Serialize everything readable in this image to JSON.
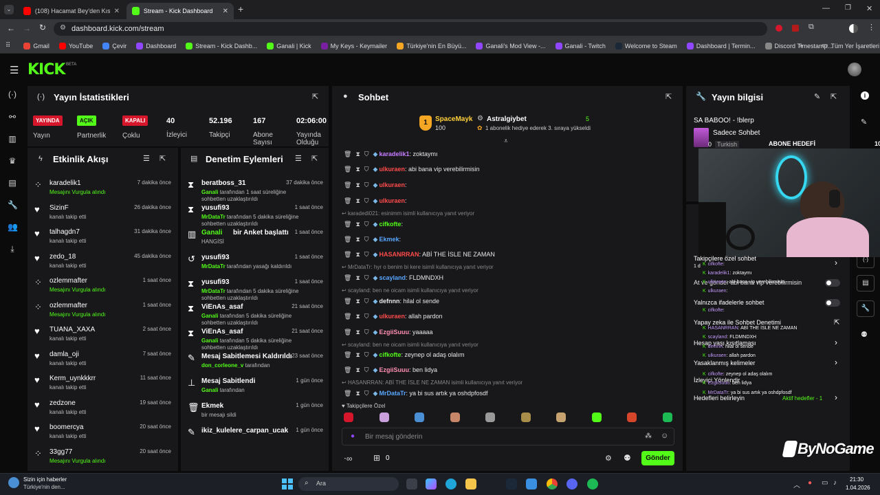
{
  "browser": {
    "tabs": [
      {
        "title": "(108) Hacamat Bey'den Kıssadan",
        "color": "#ff0000"
      },
      {
        "title": "Stream - Kick Dashboard",
        "color": "#53fc18"
      }
    ],
    "new_tab": "+",
    "url": "dashboard.kick.com/stream",
    "bookmarks": [
      {
        "label": "Gmail",
        "color": "#ea4335"
      },
      {
        "label": "YouTube",
        "color": "#ff0000"
      },
      {
        "label": "Çevir",
        "color": "#4285f4"
      },
      {
        "label": "Dashboard",
        "color": "#9146ff"
      },
      {
        "label": "Stream - Kick Dashb...",
        "color": "#53fc18"
      },
      {
        "label": "Ganali | Kick",
        "color": "#53fc18"
      },
      {
        "label": "My Keys - Keymailer",
        "color": "#7a1fa2"
      },
      {
        "label": "Türkiye'nin En Büyü...",
        "color": "#f5a623"
      },
      {
        "label": "Ganali's Mod View -...",
        "color": "#9146ff"
      },
      {
        "label": "Ganali - Twitch",
        "color": "#9146ff"
      },
      {
        "label": "Welcome to Steam",
        "color": "#1b2838"
      },
      {
        "label": "Dashboard | Termin...",
        "color": "#9146ff"
      },
      {
        "label": "Discord Timestamp...",
        "color": "#888888"
      }
    ],
    "all_bookmarks": "Tüm Yer İşaretleri"
  },
  "kick": {
    "logo": "KICK",
    "beta": "BETA"
  },
  "stats": {
    "title": "Yayın İstatistikleri",
    "items": [
      {
        "badge": "YAYINDA",
        "badge_color": "#d6162b",
        "label": "Yayın"
      },
      {
        "badge": "AÇIK",
        "badge_color": "#53fc18",
        "label": "Partnerlik"
      },
      {
        "badge": "KAPALI",
        "badge_color": "#d6162b",
        "label": "Çoklu"
      },
      {
        "value": "40",
        "label": "İzleyici"
      },
      {
        "value": "52.196",
        "label": "Takipçi"
      },
      {
        "value": "167",
        "label": "Abone Sayısı"
      },
      {
        "value": "02:06:00",
        "label": "Yayında Olduğu"
      }
    ]
  },
  "activity": {
    "title": "Etkinlik Akışı",
    "items": [
      {
        "name": "karadelik1",
        "desc": "Mesajını Vurgula alındı",
        "highlight": true,
        "time": "7 dakika önce"
      },
      {
        "name": "SizinF",
        "desc": "kanalı takip etti",
        "highlight": false,
        "time": "26 dakika önce"
      },
      {
        "name": "talhagdn7",
        "desc": "kanalı takip etti",
        "highlight": false,
        "time": "31 dakika önce"
      },
      {
        "name": "zedo_18",
        "desc": "kanalı takip etti",
        "highlight": false,
        "time": "45 dakika önce"
      },
      {
        "name": "ozlemmafter",
        "desc": "Mesajını Vurgula alındı",
        "highlight": true,
        "time": "1 saat önce"
      },
      {
        "name": "ozlemmafter",
        "desc": "Mesajını Vurgula alındı",
        "highlight": true,
        "time": "1 saat önce"
      },
      {
        "name": "TUANA_XAXA",
        "desc": "kanalı takip etti",
        "highlight": false,
        "time": "2 saat önce"
      },
      {
        "name": "damla_oji",
        "desc": "kanalı takip etti",
        "highlight": false,
        "time": "7 saat önce"
      },
      {
        "name": "Kerm_uynkkkrr",
        "desc": "kanalı takip etti",
        "highlight": false,
        "time": "11 saat önce"
      },
      {
        "name": "zedzone",
        "desc": "kanalı takip etti",
        "highlight": false,
        "time": "19 saat önce"
      },
      {
        "name": "boomercya",
        "desc": "kanalı takip etti",
        "highlight": false,
        "time": "20 saat önce"
      },
      {
        "name": "33gg77",
        "desc": "Mesajını Vurgula alındı",
        "highlight": true,
        "time": "20 saat önce"
      }
    ]
  },
  "moderation": {
    "title": "Denetim Eylemleri",
    "items": [
      {
        "icon": "⧗",
        "title": "beratboss_31",
        "actor": "Ganali",
        "desc": "tarafından 1 saat süreliğine sohbetten uzaklaştırıldı",
        "time": "37 dakika önce"
      },
      {
        "icon": "⧗",
        "title": "yusufi93",
        "actor": "MrDataTr",
        "desc": "tarafından 5 dakika süreliğine sohbetten uzaklaştırıldı",
        "time": "1 saat önce"
      },
      {
        "icon": "▥",
        "title": "bir Anket başlattı",
        "actor": "Ganali",
        "desc": "HANGİSİ",
        "time": "1 saat önce"
      },
      {
        "icon": "↺",
        "title": "yusufi93",
        "actor": "MrDataTr",
        "desc": "tarafından yasağı kaldırıldı",
        "time": "1 saat önce"
      },
      {
        "icon": "⧗",
        "title": "yusufi93",
        "actor": "MrDataTr",
        "desc": "tarafından 5 dakika süreliğine sohbetten uzaklaştırıldı",
        "time": "1 saat önce"
      },
      {
        "icon": "⧗",
        "title": "ViEnAs_asaf",
        "actor": "Ganali",
        "desc": "tarafından 5 dakika süreliğine sohbetten uzaklaştırıldı",
        "time": "21 saat önce"
      },
      {
        "icon": "⧗",
        "title": "ViEnAs_asaf",
        "actor": "Ganali",
        "desc": "tarafından 5 dakika süreliğine sohbetten uzaklaştırıldı",
        "time": "21 saat önce"
      },
      {
        "icon": "✎",
        "title": "Mesaj Sabitlemesi Kaldırıldı",
        "actor": "don_corleone_v",
        "desc": "tarafından",
        "time": "23 saat önce"
      },
      {
        "icon": "⊥",
        "title": "Mesaj Sabitlendi",
        "actor": "Ganali",
        "desc": "tarafından",
        "time": "1 gün önce"
      },
      {
        "icon": "🗑",
        "title": "Ekmek",
        "actor": "",
        "desc": "bir mesajı sildi",
        "time": "1 gün önce"
      },
      {
        "icon": "✎",
        "title": "ikiz_kulelere_carpan_ucak",
        "actor": "",
        "desc": "",
        "time": "1 gün önce"
      }
    ]
  },
  "chat": {
    "title": "Sohbet",
    "gift": {
      "user1": "SpaceMayk",
      "count": "100",
      "rank": "1",
      "user2": "Astralgiybet",
      "num": "5",
      "text": "1 abonelik hediye ederek 3. sıraya yükseldi"
    },
    "messages": [
      {
        "user": "karadelik1",
        "color": "#c77dff",
        "text": ": zoktaymı"
      },
      {
        "user": "ulkuraen",
        "color": "#ff4b4b",
        "text": ": abi bana vip verebilirmisin"
      },
      {
        "user": "ulkuraen",
        "color": "#ff4b4b",
        "text": ":"
      },
      {
        "user": "ulkuraen",
        "color": "#ff4b4b",
        "text": ":"
      },
      {
        "reply": "karadedi021: esinimm isimli kullanıcıya yanıt veriyor"
      },
      {
        "user": "cifkofte",
        "color": "#53fc18",
        "text": ":"
      },
      {
        "user": "Ekmek",
        "color": "#58a6ff",
        "text": ":"
      },
      {
        "user": "HASANRRAN",
        "color": "#ff4b4b",
        "text": ": ABİ THE İSLE NE ZAMAN"
      },
      {
        "reply": "MrDataTr: hyr o benim bi kere isimli kullanıcıya yanıt veriyor"
      },
      {
        "user": "scayland",
        "color": "#58a6ff",
        "text": ": FLDMNDXH"
      },
      {
        "reply": "scayland: ben ne oicam isimli kullanıcıya yanıt veriyor"
      },
      {
        "user": "defnnn",
        "color": "#e8e8e8",
        "text": ": hilal ol sende"
      },
      {
        "user": "ulkuraen",
        "color": "#ff4b4b",
        "text": ": allah pardon"
      },
      {
        "user": "EzgiiSuuu",
        "color": "#ff8fb1",
        "text": ": yaaaaa"
      },
      {
        "reply": "scayland: ben ne oicam isimli kullanıcıya yanıt veriyor"
      },
      {
        "user": "cifkofte",
        "color": "#53fc18",
        "text": ": zeynep ol adaş olalım"
      },
      {
        "user": "EzgiiSuuu",
        "color": "#ff8fb1",
        "text": ": ben lidya"
      },
      {
        "reply": "HASANRRAN: ABİ THE İSLE NE ZAMAN isimli kullanıcıya yanıt veriyor"
      },
      {
        "user": "MrDataTr",
        "color": "#58a6ff",
        "text": ": ya bi sus artık ya oshdpfosdf"
      }
    ],
    "followers_only": "Takipçilere Özel",
    "input_placeholder": "Bir mesaj gönderin",
    "points": "0",
    "send": "Gönder"
  },
  "info": {
    "title": "Yayın bilgisi",
    "stream_title": "SA BABOO! - !blerp",
    "category": "Sadece Sohbet",
    "viewers": "0",
    "lang": "Turkish",
    "goal": "ABONE HEDEFİ",
    "goal_num": "10"
  },
  "settings": {
    "followers_chat": "Takipçilere özel sohbet",
    "followers_chat_sub": "1 d",
    "chat_row2": "At ve gönder abi bana vip verebilirmisin",
    "emotes_chat": "Yalnızca ifadelerle sohbet",
    "ai_mod": "Yapay zeka ile Sohbet Denetimi",
    "account_limit": "Hesap yaşı kısıtlaması",
    "banned_words": "Yasaklanmış kelimeler",
    "viewer_redirect": "İzleyici Yönlendir",
    "goals": "Hedefleri belirleyin",
    "active_goals": "Aktif hedefler - 1"
  },
  "overlay_chat": [
    {
      "user": "cifkofte",
      "text": ":"
    },
    {
      "user": "karadelik1",
      "text": ": zoktaymı"
    },
    {
      "user": "ulkuraen",
      "text": ": abi bana vip verebilirmisin"
    },
    {
      "user": "ulkuraen",
      "text": ":"
    },
    {
      "user": "cifkofte",
      "text": ":"
    },
    {
      "user": "HASANRRAN",
      "text": ": ABİ THE İSLE NE ZAMAN"
    },
    {
      "user": "scayland",
      "text": ": FLDMNDXH"
    },
    {
      "user": "defnnn",
      "text": ": hilal ol sende"
    },
    {
      "user": "ulkuraen",
      "text": ": allah pardon"
    },
    {
      "user": "cifkofte",
      "text": ": zeynep ol adaş olalım"
    },
    {
      "user": "EzgiiSuuu",
      "text": ": ben lidya"
    },
    {
      "user": "MrDataTr",
      "text": ": ya bi sus artık ya oshdpfosdf"
    }
  ],
  "watermark": "ByNoGame",
  "taskbar": {
    "news_title": "Sizin için haberler",
    "news_sub": "Türkiye'nin den...",
    "search": "Ara",
    "time": "21:30",
    "date": "1.04.2026"
  }
}
